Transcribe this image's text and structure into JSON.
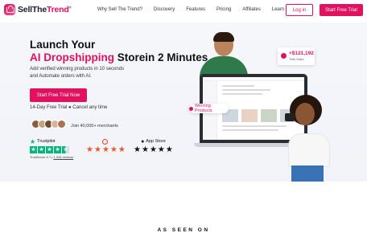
{
  "brand": {
    "part1": "Sell",
    "part2": "The",
    "part3": "Trend",
    "trademark": "®"
  },
  "nav": {
    "links": [
      "Why Sell The Trend?",
      "Discovery",
      "Features",
      "Pricing",
      "Affiliates",
      "Learn"
    ],
    "login_label": "Log in",
    "trial_label": "Start Free Trial"
  },
  "hero": {
    "headline_line1": "Launch Your",
    "headline_pink": "AI Dropshipping",
    "headline_rest": " Storein 2 Minutes",
    "sub_line1": "Add verified winning products in 10 seconds",
    "sub_line2": "and Automate orders with AI.",
    "cta_label": "Start Free Trial Now",
    "trial_note": "14-Day Free Trial ● Cancel any time",
    "merchants": "Join 40,000+ merchants"
  },
  "ratings": [
    {
      "label": "Trustpilot",
      "stars": 4.5
    },
    {
      "label": "",
      "stars": 5
    },
    {
      "label": "App Store",
      "stars": 5
    }
  ],
  "trustpilot_score": "TrustScore 4.7",
  "trustpilot_reviews": "1,318 reviews",
  "illustration": {
    "sales_value": "+$121,192",
    "sales_label": "Total Sales",
    "pill_label": "Winning Products"
  },
  "as_seen_on": "AS SEEN ON",
  "colors": {
    "accent": "#e2115f",
    "trustpilot": "#00b67a",
    "hero_bg": "#f3f4f8"
  },
  "icons": {
    "logo": "cart-icon",
    "sales": "dollar-icon",
    "pill": "flame-icon"
  }
}
